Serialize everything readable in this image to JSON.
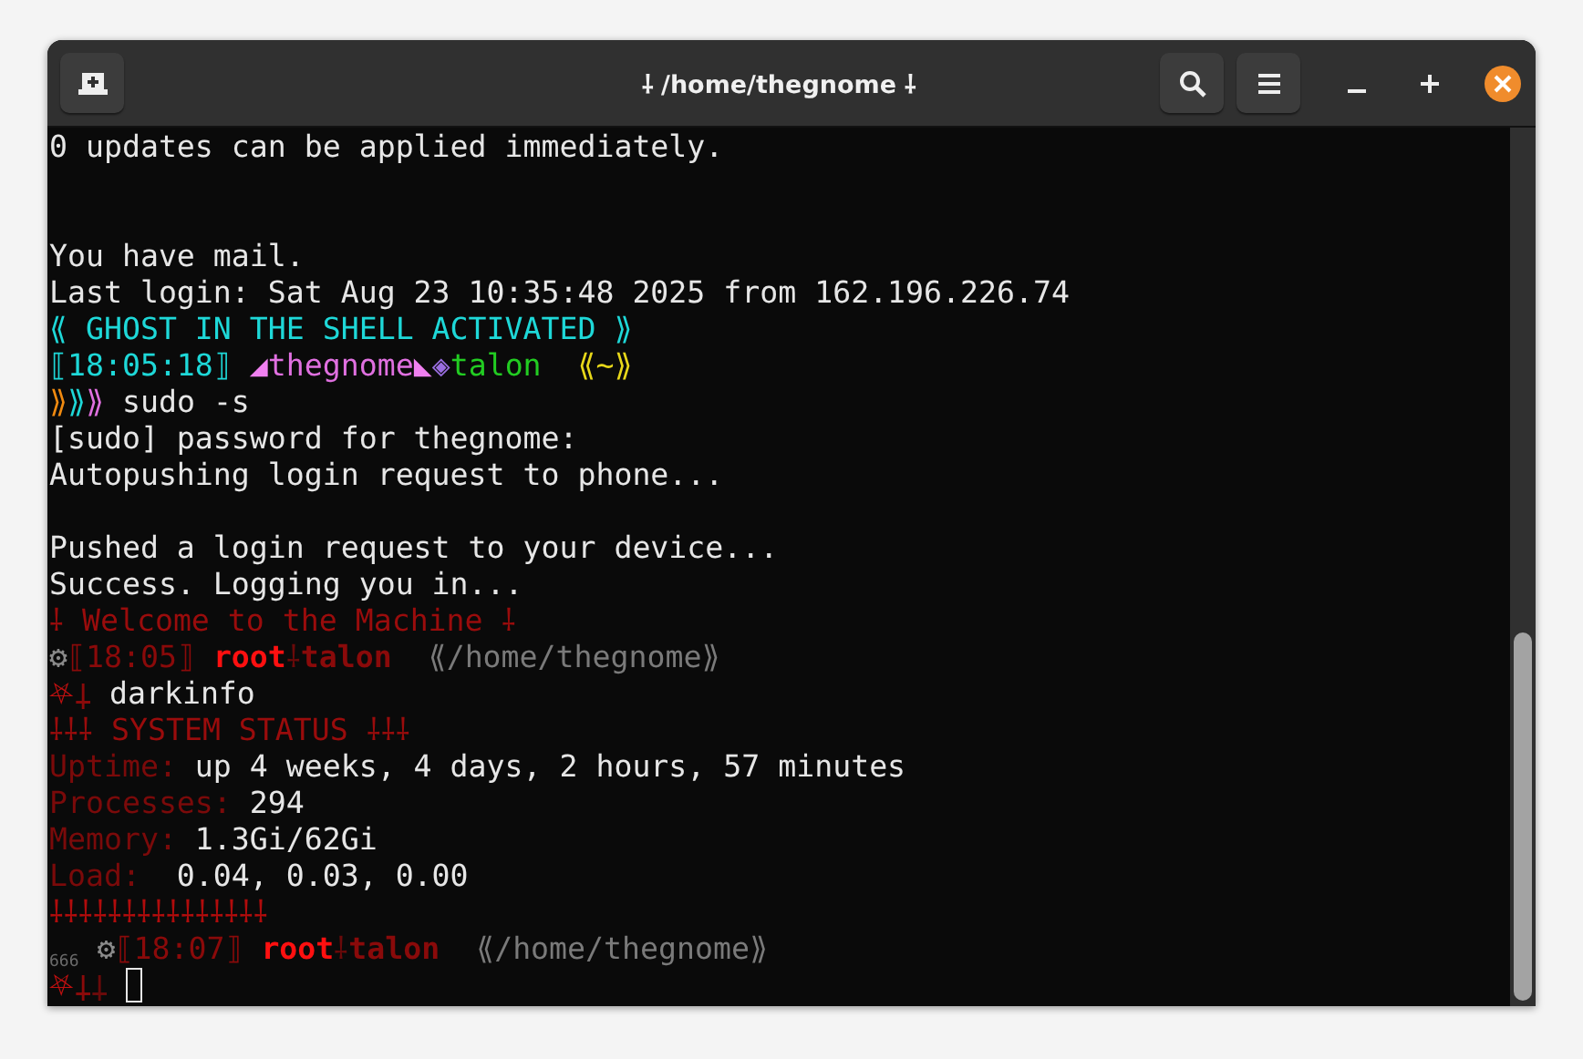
{
  "window": {
    "title": "⸸ /home/thegnome ⸸"
  },
  "terminal": {
    "lines": [
      {
        "kind": "text",
        "segments": [
          {
            "text": "0 updates can be applied immediately.",
            "color": "#e6e6e6",
            "bold": false
          }
        ]
      },
      {
        "kind": "blank"
      },
      {
        "kind": "blank"
      },
      {
        "kind": "text",
        "segments": [
          {
            "text": "You have mail.",
            "color": "#e6e6e6",
            "bold": false
          }
        ]
      },
      {
        "kind": "text",
        "segments": [
          {
            "text": "Last login: Sat Aug 23 10:35:48 2025 from 162.196.226.74",
            "color": "#e6e6e6",
            "bold": false
          }
        ]
      },
      {
        "kind": "text",
        "segments": [
          {
            "text": "⟪ GHOST IN THE SHELL ACTIVATED ⟫",
            "color": "#1ed8d8",
            "bold": false
          }
        ]
      },
      {
        "kind": "text",
        "segments": [
          {
            "text": "⟦18:05:18⟧ ",
            "color": "#1ed8d8",
            "bold": false
          },
          {
            "text": "◢",
            "color": "#f080f0"
          },
          {
            "text": "thegnome",
            "color": "#e070e0",
            "bold": false
          },
          {
            "text": "◣",
            "color": "#f080f0"
          },
          {
            "text": "◈",
            "color": "#9a6ee0",
            "bold": false
          },
          {
            "text": "talon  ",
            "color": "#22cc22",
            "bold": false
          },
          {
            "text": "⟪~⟫",
            "color": "#e8d81a",
            "bold": false
          }
        ]
      },
      {
        "kind": "text",
        "segments": [
          {
            "text": "⟫",
            "color": "#f08a10",
            "bold": false
          },
          {
            "text": "⟫",
            "color": "#1ed8d8",
            "bold": false
          },
          {
            "text": "⟫",
            "color": "#e070e0",
            "bold": false
          },
          {
            "text": " sudo -s",
            "color": "#e6e6e6",
            "bold": false
          }
        ]
      },
      {
        "kind": "text",
        "segments": [
          {
            "text": "[sudo] password for thegnome:",
            "color": "#e6e6e6",
            "bold": false
          }
        ]
      },
      {
        "kind": "text",
        "segments": [
          {
            "text": "Autopushing login request to phone...",
            "color": "#e6e6e6",
            "bold": false
          }
        ]
      },
      {
        "kind": "blank"
      },
      {
        "kind": "text",
        "segments": [
          {
            "text": "Pushed a login request to your device...",
            "color": "#e6e6e6",
            "bold": false
          }
        ]
      },
      {
        "kind": "text",
        "segments": [
          {
            "text": "Success. Logging you in...",
            "color": "#e6e6e6",
            "bold": false
          }
        ]
      },
      {
        "kind": "text",
        "segments": [
          {
            "text": "⸸ Welcome to the Machine ⸸",
            "color": "#9a0c0c",
            "bold": false
          }
        ]
      },
      {
        "kind": "text",
        "segments": [
          {
            "text": "⚙",
            "color": "#8a8a8a"
          },
          {
            "text": "⟦18:05⟧ ",
            "color": "#8a0a0a",
            "bold": false
          },
          {
            "text": "root",
            "color": "#ff1010",
            "bold": true
          },
          {
            "text": "⸸",
            "color": "#6a0a0a",
            "bold": false
          },
          {
            "text": "talon",
            "color": "#8a0a0a",
            "bold": true
          },
          {
            "text": "  ⟪/home/thegnome⟫",
            "color": "#7a7a7a",
            "bold": false
          }
        ]
      },
      {
        "kind": "text",
        "segments": [
          {
            "text": "⛧",
            "color": "#c01010",
            "bold": false
          },
          {
            "text": "⸸",
            "color": "#8a0a0a",
            "bold": false
          },
          {
            "text": " darkinfo",
            "color": "#e6e6e6",
            "bold": false
          }
        ]
      },
      {
        "kind": "text",
        "segments": [
          {
            "text": "⸸⸸⸸ SYSTEM STATUS ⸸⸸⸸",
            "color": "#9a0c0c",
            "bold": false
          }
        ]
      },
      {
        "kind": "text",
        "segments": [
          {
            "text": "Uptime:",
            "color": "#7a0a0a",
            "bold": false
          },
          {
            "text": " up 4 weeks, 4 days, 2 hours, 57 minutes",
            "color": "#e6e6e6",
            "bold": false
          }
        ]
      },
      {
        "kind": "text",
        "segments": [
          {
            "text": "Processes:",
            "color": "#7a0a0a",
            "bold": false
          },
          {
            "text": " 294",
            "color": "#e6e6e6",
            "bold": false
          }
        ]
      },
      {
        "kind": "text",
        "segments": [
          {
            "text": "Memory:",
            "color": "#7a0a0a",
            "bold": false
          },
          {
            "text": " 1.3Gi/62Gi",
            "color": "#e6e6e6",
            "bold": false
          }
        ]
      },
      {
        "kind": "text",
        "segments": [
          {
            "text": "Load:",
            "color": "#7a0a0a",
            "bold": false
          },
          {
            "text": "  0.04, 0.03, 0.00",
            "color": "#e6e6e6",
            "bold": false
          }
        ]
      },
      {
        "kind": "text",
        "segments": [
          {
            "text": "⸸⸸⸸⸸⸸⸸⸸⸸⸸⸸⸸⸸⸸⸸⸸",
            "color": "#b00c0c",
            "bold": false
          }
        ]
      },
      {
        "kind": "text",
        "segments": [
          {
            "text": "666",
            "color": "#6a6a6a",
            "bold": false,
            "small": true
          },
          {
            "text": " ⚙",
            "color": "#8a8a8a"
          },
          {
            "text": "⟦18:07⟧ ",
            "color": "#8a0a0a",
            "bold": false
          },
          {
            "text": "root",
            "color": "#ff1010",
            "bold": true
          },
          {
            "text": "⸸",
            "color": "#6a0a0a",
            "bold": false
          },
          {
            "text": "talon",
            "color": "#8a0a0a",
            "bold": true
          },
          {
            "text": "  ⟪/home/thegnome⟫",
            "color": "#7a7a7a",
            "bold": false
          }
        ]
      },
      {
        "kind": "cursor-line",
        "segments": [
          {
            "text": "⛧",
            "color": "#c01010",
            "bold": false
          },
          {
            "text": "⸸",
            "color": "#8a0a0a",
            "bold": false
          },
          {
            "text": "⸸ ",
            "color": "#6a0a0a",
            "bold": false
          }
        ]
      }
    ]
  }
}
